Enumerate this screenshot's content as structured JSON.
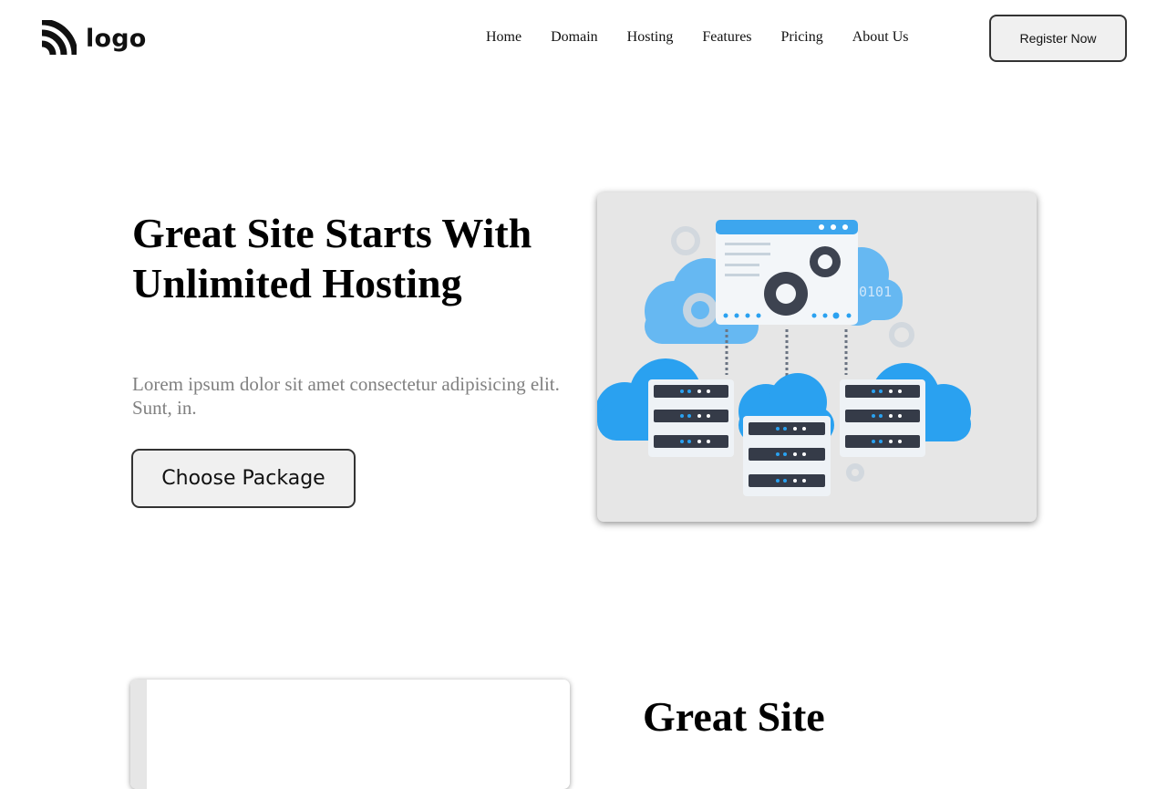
{
  "header": {
    "logo_text": "logo",
    "nav": [
      "Home",
      "Domain",
      "Hosting",
      "Features",
      "Pricing",
      "About Us"
    ],
    "register_label": "Register Now"
  },
  "hero": {
    "title": "Great Site Starts With Unlimited Hosting",
    "subtitle": "Lorem ipsum dolor sit amet consectetur adipisicing elit. Sunt, in.",
    "cta_label": "Choose Package",
    "illustration_text": "0101"
  },
  "section2": {
    "title": "Great Site"
  },
  "colors": {
    "illustration_blue": "#2aa1f0",
    "server_dark": "#353b48",
    "card_bg": "#e6e6e6"
  },
  "icons": [
    "logo-mark-icon",
    "gear-icon",
    "cloud-icon",
    "server-icon"
  ]
}
